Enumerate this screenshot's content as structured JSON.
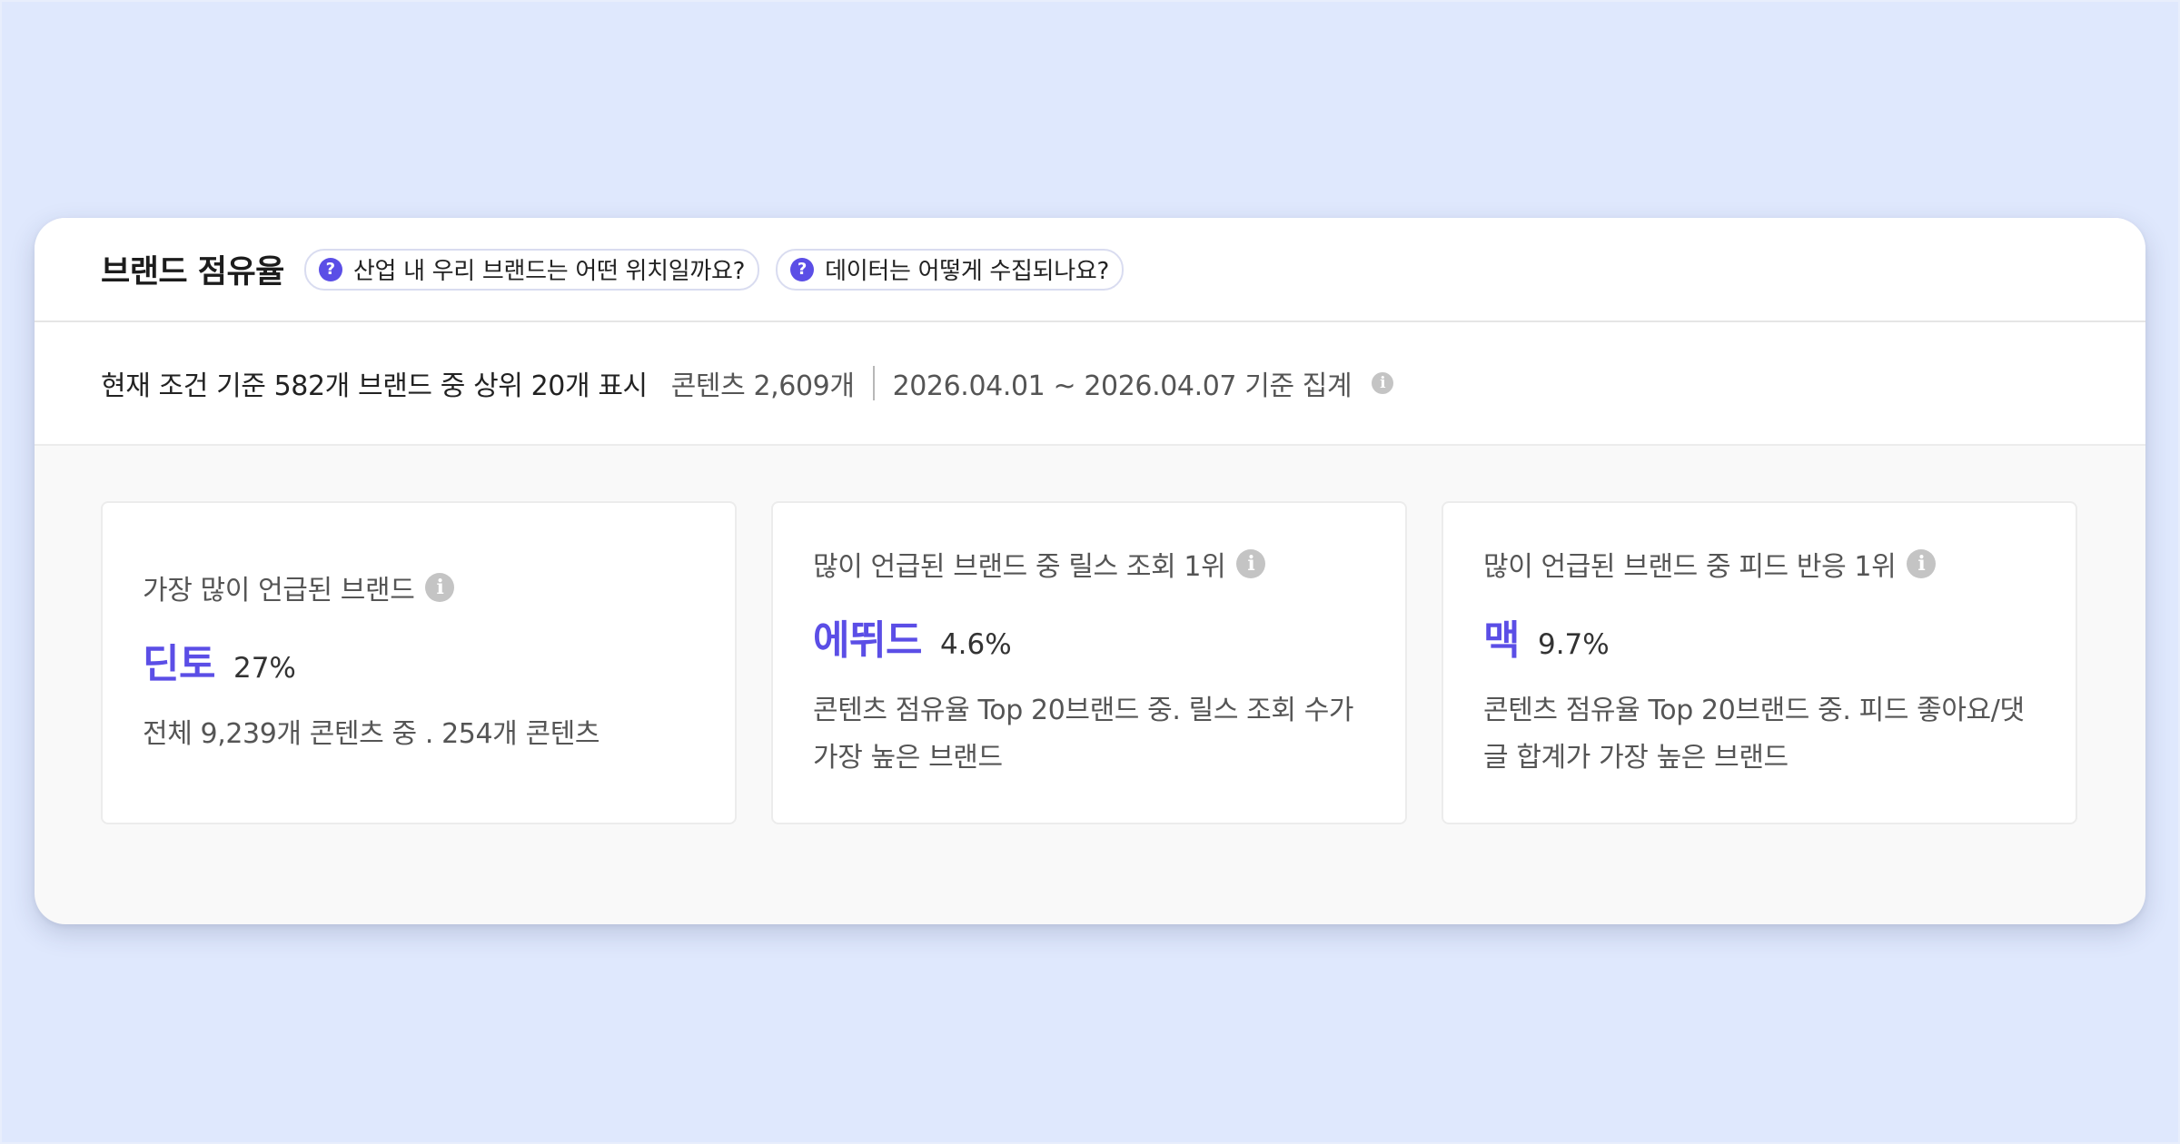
{
  "panel": {
    "title": "브랜드 점유율",
    "help_chips": [
      {
        "icon": "question-icon",
        "label": "산업 내 우리 브랜드는 어떤 위치일까요?"
      },
      {
        "icon": "question-icon",
        "label": "데이터는 어떻게 수집되나요?"
      }
    ]
  },
  "summary": {
    "main": "현재 조건 기준 582개 브랜드 중 상위 20개 표시",
    "content_count": "콘텐츠 2,609개",
    "date_range": "2026.04.01 ~ 2026.04.07 기준 집계",
    "info_icon": "info-icon"
  },
  "cards": [
    {
      "title": "가장 많이 언급된 브랜드",
      "brand": "딘토",
      "percent": "27%",
      "description": "전체 9,239개 콘텐츠 중 . 254개 콘텐츠"
    },
    {
      "title": "많이 언급된 브랜드 중 릴스 조회 1위",
      "brand": "에뛰드",
      "percent": "4.6%",
      "description": "콘텐츠 점유율 Top 20브랜드 중. 릴스 조회 수가 가장 높은 브랜드"
    },
    {
      "title": "많이 언급된 브랜드 중 피드 반응 1위",
      "brand": "맥",
      "percent": "9.7%",
      "description": "콘텐츠 점유율 Top 20브랜드 중. 피드 좋아요/댓글 합계가 가장 높은 브랜드"
    }
  ],
  "colors": {
    "accent": "#5b4ee6",
    "background": "#dfe8fd",
    "panel": "#f9f9f9"
  }
}
